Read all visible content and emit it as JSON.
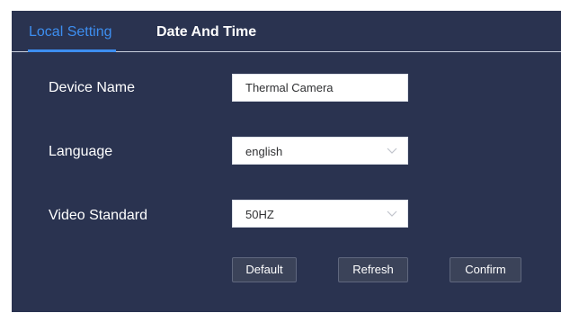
{
  "tabs": {
    "local_setting": "Local Setting",
    "date_and_time": "Date And Time"
  },
  "form": {
    "device_name": {
      "label": "Device Name",
      "value": "Thermal Camera"
    },
    "language": {
      "label": "Language",
      "value": "english"
    },
    "video_standard": {
      "label": "Video Standard",
      "value": "50HZ"
    }
  },
  "buttons": {
    "default": "Default",
    "refresh": "Refresh",
    "confirm": "Confirm"
  },
  "colors": {
    "panel_background": "#2a3350",
    "active_tab": "#3d8ef0",
    "button_background": "#3b4359"
  },
  "icons": {
    "dropdown": "chevron-down-icon"
  }
}
